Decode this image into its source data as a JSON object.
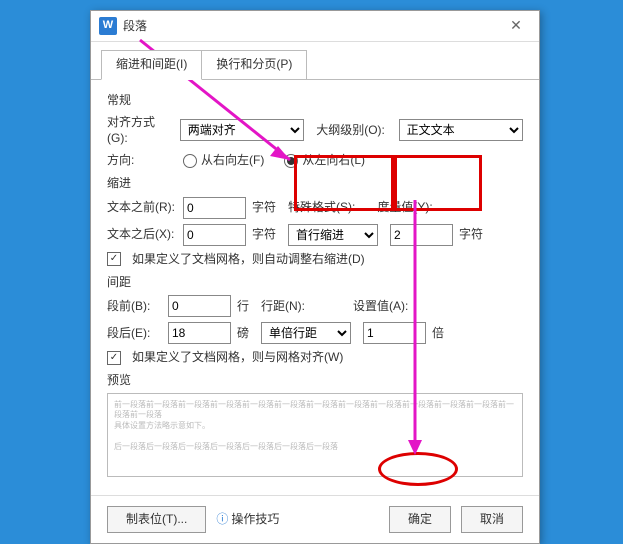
{
  "window": {
    "title": "段落"
  },
  "tabs": {
    "indent": "缩进和间距(I)",
    "page": "换行和分页(P)"
  },
  "general": {
    "heading": "常规",
    "align_label": "对齐方式(G):",
    "align_value": "两端对齐",
    "outline_label": "大纲级别(O):",
    "outline_value": "正文文本",
    "direction_label": "方向:",
    "dir_rtl": "从右向左(F)",
    "dir_ltr": "从左向右(L)"
  },
  "indent": {
    "heading": "缩进",
    "before_label": "文本之前(R):",
    "before_value": "0",
    "before_unit": "字符",
    "after_label": "文本之后(X):",
    "after_value": "0",
    "after_unit": "字符",
    "special_label": "特殊格式(S):",
    "special_value": "首行缩进",
    "measure_label": "度量值(Y):",
    "measure_value": "2",
    "measure_unit": "字符",
    "grid_check": "如果定义了文档网格，则自动调整右缩进(D)"
  },
  "spacing": {
    "heading": "间距",
    "before_label": "段前(B):",
    "before_value": "0",
    "before_unit": "行",
    "after_label": "段后(E):",
    "after_value": "18",
    "after_unit": "磅",
    "line_label": "行距(N):",
    "line_value": "单倍行距",
    "setval_label": "设置值(A):",
    "setval_value": "1",
    "setval_unit": "倍",
    "grid_check": "如果定义了文档网格，则与网格对齐(W)"
  },
  "preview": {
    "heading": "预览",
    "body": "具体设置方法略示意如下。"
  },
  "footer": {
    "tabs": "制表位(T)...",
    "tips": "操作技巧",
    "ok": "确定",
    "cancel": "取消"
  }
}
